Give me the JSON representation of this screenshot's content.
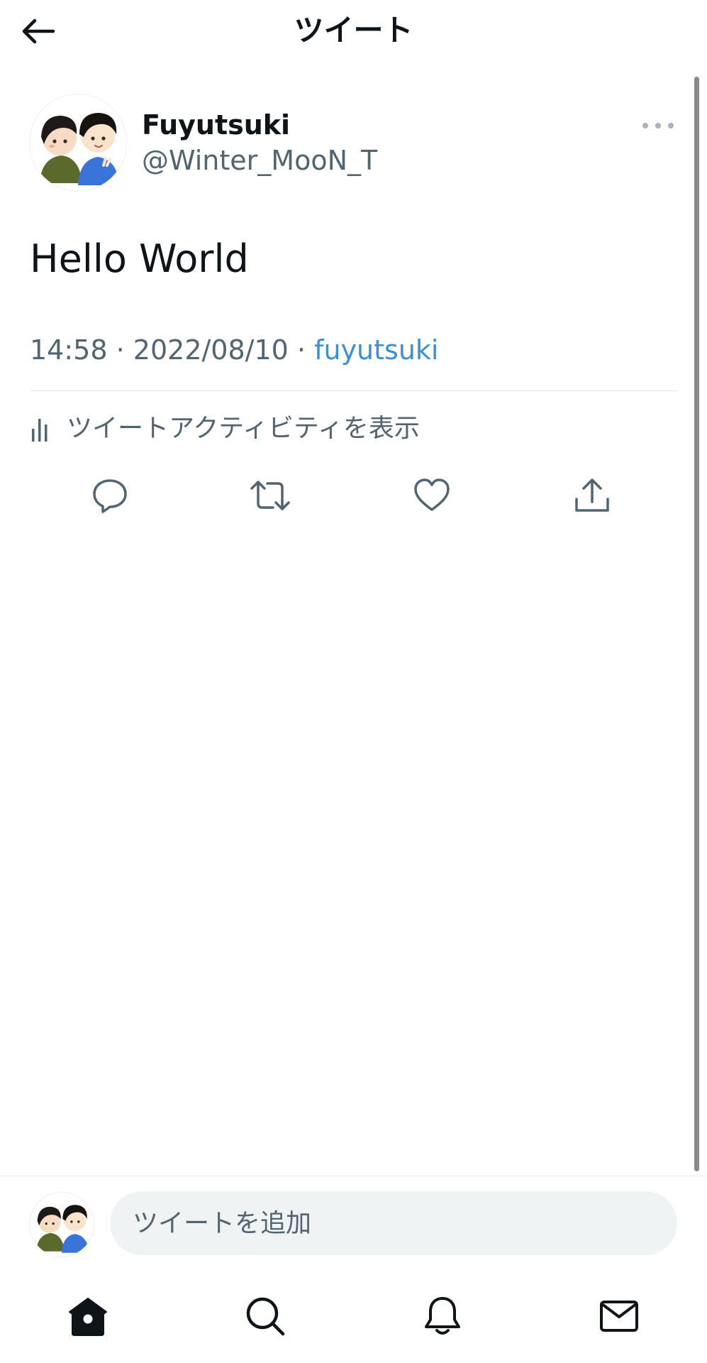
{
  "header": {
    "title": "ツイート",
    "back_icon": "arrow-left-icon"
  },
  "tweet": {
    "author": {
      "display_name": "Fuyutsuki",
      "handle": "@Winter_MooN_T"
    },
    "text": "Hello World",
    "time": "14:58",
    "date": "2022/08/10",
    "separator": "·",
    "source": "fuyutsuki",
    "activity_label": "ツイートアクティビティを表示"
  },
  "actions": [
    {
      "name": "reply",
      "icon": "reply-icon"
    },
    {
      "name": "retweet",
      "icon": "retweet-icon"
    },
    {
      "name": "like",
      "icon": "heart-icon"
    },
    {
      "name": "share",
      "icon": "share-icon"
    }
  ],
  "reply": {
    "placeholder": "ツイートを追加"
  },
  "tabbar": [
    {
      "name": "home",
      "icon": "home-icon",
      "active": true
    },
    {
      "name": "search",
      "icon": "search-icon",
      "active": false
    },
    {
      "name": "notifications",
      "icon": "bell-icon",
      "active": false
    },
    {
      "name": "messages",
      "icon": "mail-icon",
      "active": false
    }
  ],
  "colors": {
    "text_primary": "#0f1419",
    "text_secondary": "#536471",
    "link": "#3f8fd0",
    "input_bg": "#eff3f4",
    "divider": "#dfe4e8"
  }
}
